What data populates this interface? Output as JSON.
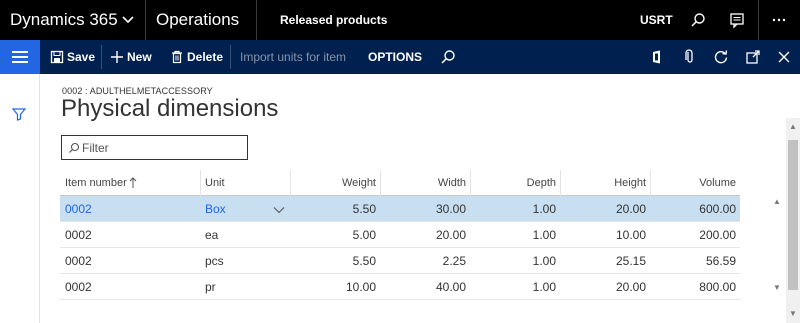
{
  "navbar": {
    "brand": "Dynamics 365",
    "module": "Operations",
    "breadcrumb": "Released products",
    "company": "USRT"
  },
  "actionbar": {
    "save_label": "Save",
    "new_label": "New",
    "delete_label": "Delete",
    "import_label": "Import units for item",
    "options_label": "OPTIONS"
  },
  "form": {
    "item_id": "0002 : ADULTHELMETACCESSORY",
    "title": "Physical dimensions",
    "filter_placeholder": "Filter"
  },
  "grid": {
    "columns": [
      "Item number",
      "Unit",
      "Weight",
      "Width",
      "Depth",
      "Height",
      "Volume"
    ],
    "rows": [
      {
        "item": "0002",
        "unit": "Box",
        "weight": "5.50",
        "width": "30.00",
        "depth": "1.00",
        "height": "20.00",
        "volume": "600.00"
      },
      {
        "item": "0002",
        "unit": "ea",
        "weight": "5.00",
        "width": "20.00",
        "depth": "1.00",
        "height": "10.00",
        "volume": "200.00"
      },
      {
        "item": "0002",
        "unit": "pcs",
        "weight": "5.50",
        "width": "2.25",
        "depth": "1.00",
        "height": "25.15",
        "volume": "56.59"
      },
      {
        "item": "0002",
        "unit": "pr",
        "weight": "10.00",
        "width": "40.00",
        "depth": "1.00",
        "height": "20.00",
        "volume": "800.00"
      }
    ]
  },
  "colors": {
    "navbar_bg": "#000000",
    "actionbar_bg": "#002050",
    "accent": "#2266e3",
    "selected_row": "#c7dff1"
  },
  "icons": [
    "chevron-down-icon",
    "search-icon",
    "message-icon",
    "more-icon",
    "hamburger-icon",
    "save-icon",
    "plus-icon",
    "delete-icon",
    "office-icon",
    "attach-icon",
    "refresh-icon",
    "open-new-icon",
    "close-icon",
    "filter-icon"
  ]
}
